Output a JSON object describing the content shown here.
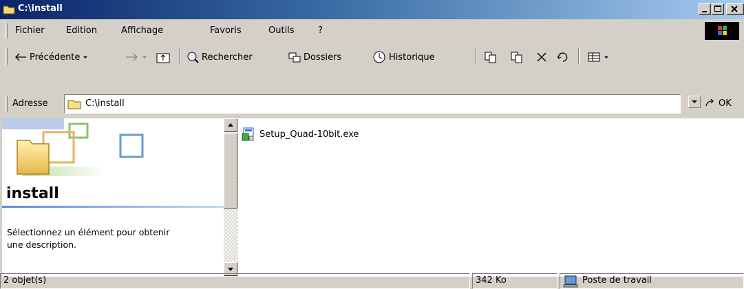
{
  "window": {
    "title": "C:\\install"
  },
  "menu": {
    "items": [
      "Fichier",
      "Edition",
      "Affichage",
      "Favoris",
      "Outils",
      "?"
    ]
  },
  "toolbar": {
    "back_label": "Précédente",
    "search_label": "Rechercher",
    "folders_label": "Dossiers",
    "history_label": "Historique"
  },
  "address": {
    "label": "Adresse",
    "value": "C:\\install",
    "go_label": "OK"
  },
  "left_pane": {
    "folder_name": "install",
    "description": "Sélectionnez un élément pour obtenir une description."
  },
  "files": [
    {
      "name": "Setup_Quad-10bit.exe",
      "icon": "installer-icon"
    }
  ],
  "status": {
    "objects": "2 objet(s)",
    "size": "342 Ko",
    "zone": "Poste de travail"
  },
  "colors": {
    "titlebar_start": "#0a246a",
    "titlebar_end": "#a6caf0",
    "chrome": "#d4d0c8"
  }
}
